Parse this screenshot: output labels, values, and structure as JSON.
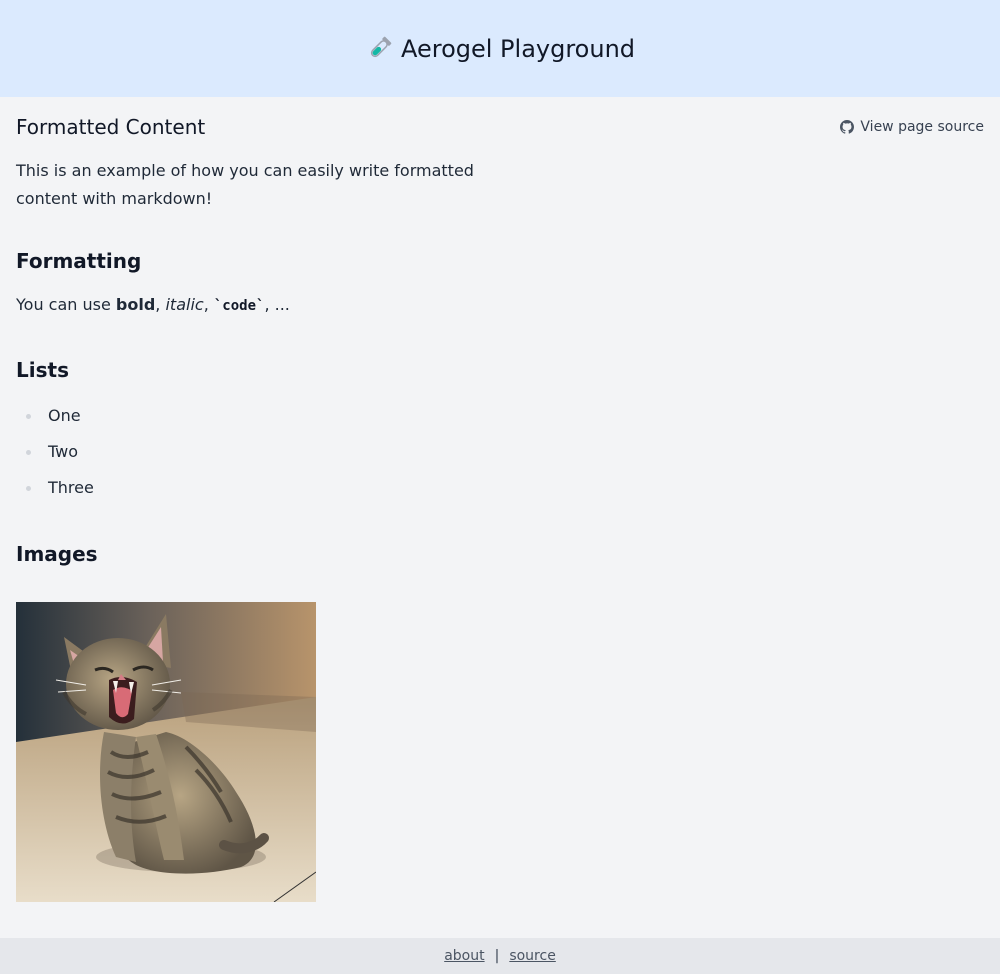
{
  "header": {
    "title": "Aerogel Playground",
    "icon": "test-tube-icon"
  },
  "page": {
    "title": "Formatted Content",
    "source_link_label": "View page source",
    "source_icon": "github-icon"
  },
  "content": {
    "intro": "This is an example of how you can easily write formatted content with markdown!",
    "formatting": {
      "heading": "Formatting",
      "prefix": "You can use ",
      "bold": "bold",
      "sep1": ", ",
      "italic": "italic",
      "sep2": ", ",
      "code": "`code`",
      "suffix": ", ..."
    },
    "lists": {
      "heading": "Lists",
      "items": [
        "One",
        "Two",
        "Three"
      ]
    },
    "images": {
      "heading": "Images"
    }
  },
  "footer": {
    "about": "about",
    "separator": "|",
    "source": "source"
  },
  "colors": {
    "header_bg": "#dbeafe",
    "page_bg": "#f3f4f6",
    "footer_bg": "#e5e7eb"
  }
}
